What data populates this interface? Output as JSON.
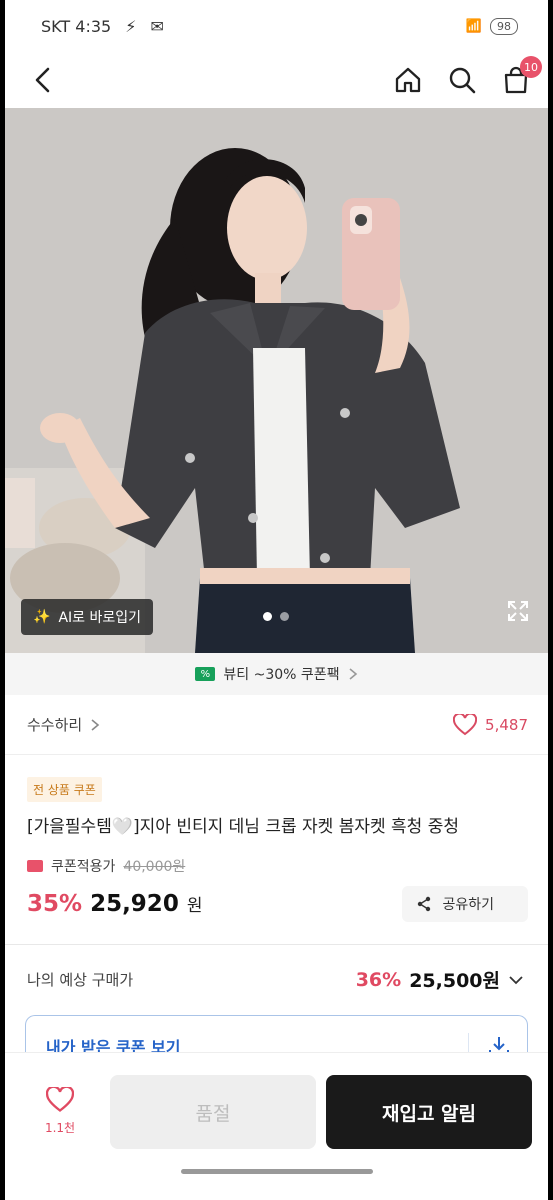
{
  "status": {
    "carrier": "SKT 4:35",
    "right_text": "",
    "battery": "98"
  },
  "header": {
    "back_icon": "chevron-left-icon",
    "cart_count": "10"
  },
  "hero": {
    "ai_label": "AI로 바로입기",
    "slide_count": 2,
    "active_slide": 1
  },
  "coupon_banner": {
    "text": "뷰티 ~30% 쿠폰팩",
    "tag_color": "#17a05a"
  },
  "store": {
    "name": "수수하리",
    "likes": "5,487"
  },
  "product": {
    "badge": "전 상품 쿠폰",
    "title": "[가을필수템🤍]지아 빈티지 데님 크롭 자켓 봄자켓 흑청 중청",
    "coupon_label": "쿠폰적용가",
    "original_price": "40,000원",
    "discount": "35%",
    "price": "25,920",
    "won": "원",
    "share_label": "공유하기"
  },
  "estimate": {
    "label": "나의 예상 구매가",
    "discount": "36%",
    "price": "25,500원"
  },
  "coupon_box": {
    "label": "내가 받은 쿠폰 보기"
  },
  "bottom_bar": {
    "wish_count": "1.1천",
    "soldout_label": "품절",
    "restock_label": "재입고 알림"
  },
  "colors": {
    "accent": "#e04a62",
    "link_blue": "#2563c8",
    "dark_button": "#1a1a1a"
  }
}
